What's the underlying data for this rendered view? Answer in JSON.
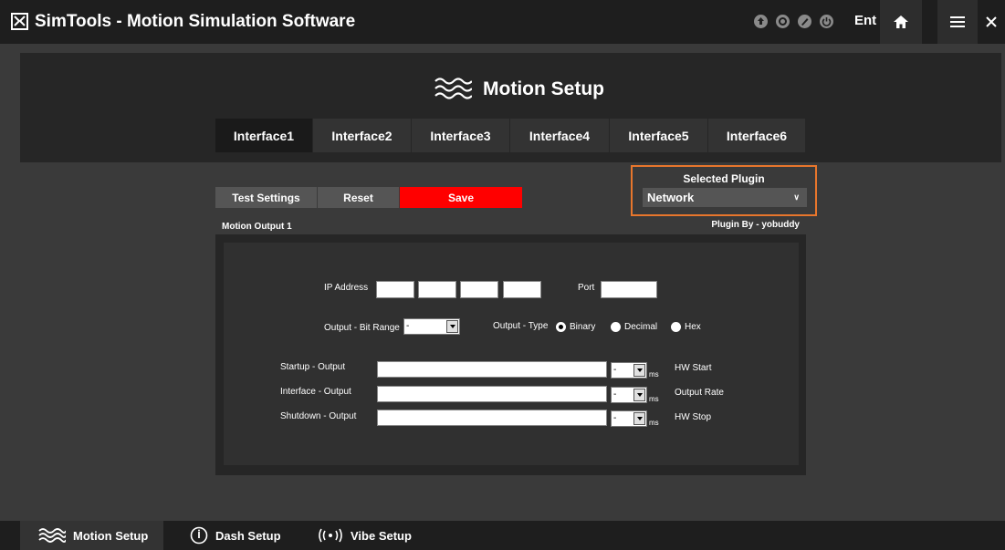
{
  "app": {
    "title": "SimTools - Motion Simulation Software",
    "language": "Ent"
  },
  "titlebar_icons": [
    "upload-icon",
    "settings-icon",
    "edit-icon",
    "power-icon",
    "home-icon",
    "menu-icon",
    "close-icon"
  ],
  "header": {
    "title": "Motion Setup",
    "icon": "waves-icon"
  },
  "tabs": [
    {
      "label": "Interface1",
      "active": true
    },
    {
      "label": "Interface2",
      "active": false
    },
    {
      "label": "Interface3",
      "active": false
    },
    {
      "label": "Interface4",
      "active": false
    },
    {
      "label": "Interface5",
      "active": false
    },
    {
      "label": "Interface6",
      "active": false
    }
  ],
  "actions": {
    "test_label": "Test Settings",
    "reset_label": "Reset",
    "save_label": "Save"
  },
  "plugin": {
    "label": "Selected Plugin",
    "value": "Network",
    "author": "Plugin By - yobuddy"
  },
  "output": {
    "section_title": "Motion Output 1",
    "ip_label": "IP Address",
    "ip_values": [
      "",
      "",
      "",
      ""
    ],
    "port_label": "Port",
    "port_value": "",
    "bit_range_label": "Output - Bit Range",
    "bit_range_value": "-",
    "type_label": "Output - Type",
    "type_options": [
      "Binary",
      "Decimal",
      "Hex"
    ],
    "type_selected": "Binary",
    "rows": [
      {
        "label": "Startup - Output",
        "value": "",
        "ms_value": "-",
        "unit": "ms",
        "right_label": "HW Start"
      },
      {
        "label": "Interface - Output",
        "value": "",
        "ms_value": "-",
        "unit": "ms",
        "right_label": "Output Rate"
      },
      {
        "label": "Shutdown - Output",
        "value": "",
        "ms_value": "-",
        "unit": "ms",
        "right_label": "HW Stop"
      }
    ]
  },
  "bottom_nav": [
    {
      "label": "Motion Setup",
      "icon": "waves-icon",
      "active": true
    },
    {
      "label": "Dash Setup",
      "icon": "gauge-icon",
      "active": false
    },
    {
      "label": "Vibe Setup",
      "icon": "vibration-icon",
      "active": false
    }
  ],
  "colors": {
    "accent_save": "#ff0000",
    "plugin_highlight": "#e8762c",
    "background": "#3a3a3a",
    "titlebar": "#1e1e1e"
  }
}
